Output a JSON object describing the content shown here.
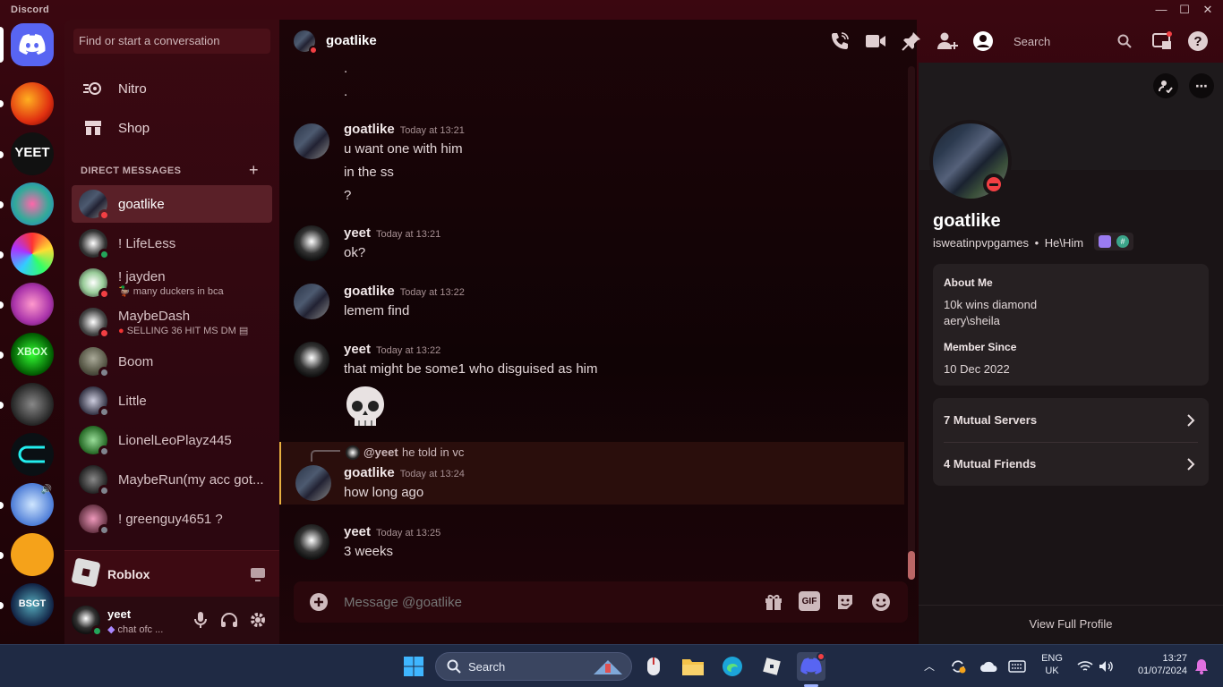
{
  "window": {
    "brand": "Discord",
    "minimize": "—",
    "maximize": "☐",
    "close": "✕"
  },
  "sidebar": {
    "search_placeholder": "Find or start a conversation",
    "nitro": "Nitro",
    "shop": "Shop",
    "dm_header": "DIRECT MESSAGES",
    "dms": [
      {
        "name": "goatlike",
        "sub": "",
        "status": "dnd"
      },
      {
        "name": "! LifeLess",
        "sub": "",
        "status": "online"
      },
      {
        "name": "! jayden",
        "sub": "many duckers in bca",
        "status": "dnd"
      },
      {
        "name": "MaybeDash",
        "sub": "SELLING 36 HIT MS DM",
        "status": "dnd"
      },
      {
        "name": "Boom",
        "sub": "",
        "status": "offline"
      },
      {
        "name": "Little",
        "sub": "",
        "status": "offline"
      },
      {
        "name": "LionelLeoPlayz445",
        "sub": "",
        "status": "offline"
      },
      {
        "name": "MaybeRun(my acc got...",
        "sub": "",
        "status": "offline"
      },
      {
        "name": "! greenguy4651 ?",
        "sub": "",
        "status": "offline"
      }
    ],
    "activity": "Roblox",
    "user": {
      "name": "yeet",
      "status_text": "chat ofc ..."
    }
  },
  "chat": {
    "channel_name": "goatlike",
    "top_search": "Search",
    "messages": [
      {
        "author": "",
        "time": "",
        "lines": [
          "."
        ]
      },
      {
        "author": "",
        "time": "",
        "lines": [
          "."
        ]
      },
      {
        "author": "goatlike",
        "time": "Today at 13:21",
        "lines": [
          "u want one with him",
          "in the ss",
          "?"
        ]
      },
      {
        "author": "yeet",
        "time": "Today at 13:21",
        "lines": [
          "ok?"
        ]
      },
      {
        "author": "goatlike",
        "time": "Today at 13:22",
        "lines": [
          "lemem find"
        ]
      },
      {
        "author": "yeet",
        "time": "Today at 13:22",
        "lines": [
          "that might be some1 who disguised as him"
        ]
      },
      {
        "author": "goatlike",
        "time": "Today at 13:24",
        "lines": [
          "how long ago"
        ],
        "reply_to": "@yeet",
        "reply_text": "he told in vc"
      },
      {
        "author": "yeet",
        "time": "Today at 13:25",
        "lines": [
          "3 weeks"
        ]
      }
    ],
    "composer_placeholder": "Message @goatlike",
    "gif": "GIF"
  },
  "profile": {
    "name": "goatlike",
    "username": "isweatinpvpgames",
    "pronouns": "He\\Him",
    "separator": "•",
    "about_title": "About Me",
    "about_lines": [
      "10k wins diamond",
      "aery\\sheila"
    ],
    "member_title": "Member Since",
    "member_since": "10 Dec 2022",
    "mutual_servers": "7 Mutual Servers",
    "mutual_friends": "4 Mutual Friends",
    "view_full": "View Full Profile"
  },
  "taskbar": {
    "search": "Search",
    "lang_top": "ENG",
    "lang_bottom": "UK",
    "time": "13:27",
    "date": "01/07/2024"
  },
  "colors": {
    "accent": "#5865f2",
    "dnd": "#f23f43",
    "online": "#23a55a",
    "offline": "#80848e"
  }
}
